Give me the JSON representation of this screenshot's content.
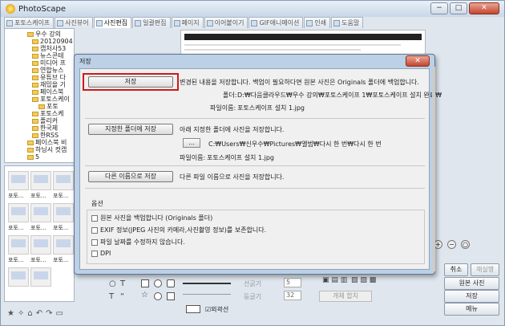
{
  "app": {
    "title": "PhotoScape"
  },
  "window_buttons": {
    "minimize": "−",
    "maximize": "□",
    "close": "✕"
  },
  "tabs": [
    {
      "label": "포토스케이프"
    },
    {
      "label": "사진뷰어"
    },
    {
      "label": "사진편집"
    },
    {
      "label": "일괄편집"
    },
    {
      "label": "페이지"
    },
    {
      "label": "이어붙이기"
    },
    {
      "label": "GIF애니메이션"
    },
    {
      "label": "인쇄"
    },
    {
      "label": "도움말"
    }
  ],
  "tree": [
    {
      "label": "우수 강의"
    },
    {
      "label": "20120904 첫교"
    },
    {
      "label": "캡처사53"
    },
    {
      "label": "뉴스콘테"
    },
    {
      "label": "미디어 프"
    },
    {
      "label": "연합뉴스"
    },
    {
      "label": "유튜브 다"
    },
    {
      "label": "재밌을 기"
    },
    {
      "label": "페이스북"
    },
    {
      "label": "포토스케이"
    },
    {
      "label": "포토"
    },
    {
      "label": "포토스케"
    },
    {
      "label": "플리커"
    },
    {
      "label": "한국제"
    },
    {
      "label": "한RSS"
    },
    {
      "label": "페이스북 비"
    },
    {
      "label": "하닝시 컷캡"
    },
    {
      "label": "5"
    }
  ],
  "thumbs": [
    "포토...",
    "포토...",
    "포토...",
    "포토...",
    "포토...",
    "포토...",
    "포토...",
    "포토...",
    "포토..."
  ],
  "right_buttons": {
    "cancel": "취소",
    "redo": "재실행",
    "original": "원본 사진",
    "save": "저장",
    "menu": "메뉴"
  },
  "tool_panel": {
    "line_thickness": "선굵기",
    "line_value": "5",
    "roundness": "둥글기",
    "round_value": "32",
    "apply": "개체 합치",
    "outline": "외곽선"
  },
  "dialog": {
    "title": "저장",
    "close": "✕",
    "save_button": "저장",
    "save_desc": "변경된 내용을 저장합니다. 백업이 필요하다면 원본 사진은 Originals 폴더에 백업합니다.",
    "folder_label": "폴더:",
    "folder_path": "D:₩다음클라우드₩우수 강의₩포토스케이프 1₩포토스케이프 설치 완료₩",
    "filename_label": "파일이름:",
    "filename": "포토스케이프 설치 1.jpg",
    "save_to_folder_button": "지정한 폴더에 저장",
    "save_to_folder_desc": "아래 지정한 폴더에 사진을 저장합니다.",
    "browse_button": "...",
    "target_path": "C:₩Users₩신우수₩Pictures₩앨범₩다시 한 번₩다시 한 번",
    "target_filename_label": "파일이름:",
    "target_filename": "포토스케이프 설치 1.jpg",
    "save_as_button": "다른 이름으로 저장",
    "save_as_desc": "다른 파일 이름으로 사진을 저장합니다.",
    "options_label": "옵션",
    "options": [
      {
        "label": "원본 사진을 백업합니다 (Originals 폴더)",
        "checked": false
      },
      {
        "label": "EXIF 정보(JPEG 사진의 카메라,사진촬영 정보)를 보존합니다.",
        "checked": false
      },
      {
        "label": "파일 날짜를 수정하지 않습니다.",
        "checked": false
      },
      {
        "label": "DPI",
        "checked": false
      }
    ]
  }
}
